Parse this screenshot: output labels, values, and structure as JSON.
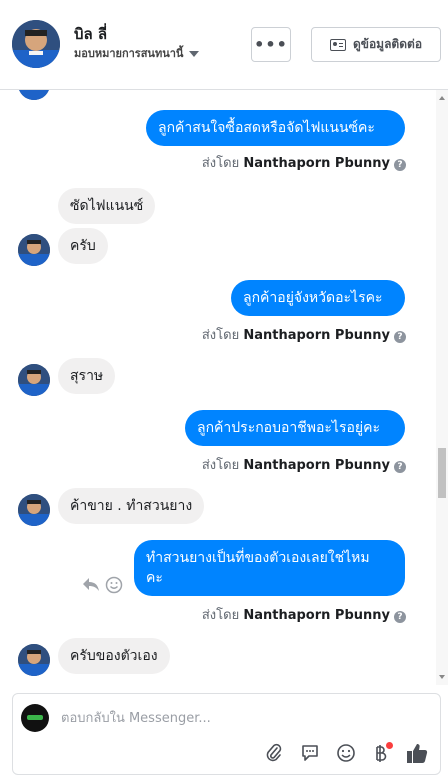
{
  "header": {
    "name": "บิล ลี่",
    "subtitle": "มอบหมายการสนทนานี้",
    "more_label": "•••",
    "contact_label": "ดูข้อมูลติดต่อ"
  },
  "messages": [
    {
      "text": "ลูกค้าสนใจซื้อสดหรือจัดไฟแนนซ์คะ",
      "sent_prefix": "ส่งโดย",
      "sender": "Nanthaporn Pbunny"
    },
    {
      "text": "ซัดไฟแนนซ์"
    },
    {
      "text": "ครับ"
    },
    {
      "text": "ลูกค้าอยู่จังหวัดอะไรคะ",
      "sent_prefix": "ส่งโดย",
      "sender": "Nanthaporn Pbunny"
    },
    {
      "text": "สุราษ"
    },
    {
      "text": "ลูกค้าประกอบอาชีพอะไรอยู่คะ",
      "sent_prefix": "ส่งโดย",
      "sender": "Nanthaporn Pbunny"
    },
    {
      "text": "ค้าขาย . ทำสวนยาง"
    },
    {
      "text_line1": "ทำสวนยางเป็นที่ของตัวเองเลยใช่ไหม",
      "text_line2": "คะ",
      "sent_prefix": "ส่งโดย",
      "sender": "Nanthaporn Pbunny"
    },
    {
      "text": "ครับของตัวเอง"
    }
  ],
  "composer": {
    "placeholder": "ตอบกลับใน Messenger..."
  },
  "icons": {
    "more": "more-icon",
    "contact": "contact-card-icon",
    "reply": "reply-icon",
    "react": "smiley-icon",
    "attach": "paperclip-icon",
    "saved_replies": "chat-bubble-icon",
    "emoji": "emoji-icon",
    "payment": "baht-icon",
    "like": "thumbs-up-icon"
  },
  "colors": {
    "outgoing": "#0084ff",
    "incoming": "#f1f0f0",
    "like": "#0084ff",
    "notification_dot": "#fa3e3e"
  }
}
